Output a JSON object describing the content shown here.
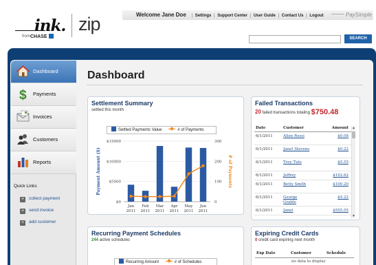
{
  "header": {
    "logo_ink": "ink.",
    "logo_from": "from",
    "logo_chase": "CHASE",
    "logo_zip": "zip",
    "welcome": "Welcome Jane Doe",
    "nav_links": [
      "Settings",
      "Support Center",
      "User Guide",
      "Contact Us",
      "Logout"
    ],
    "paysimple": "PaySimple",
    "search_button": "SEARCH",
    "search_value": ""
  },
  "sidebar": {
    "items": [
      {
        "label": "Dashboard",
        "icon": "house-icon",
        "active": true
      },
      {
        "label": "Payments",
        "icon": "dollar-icon"
      },
      {
        "label": "Invoices",
        "icon": "envelope-icon"
      },
      {
        "label": "Customers",
        "icon": "people-icon"
      },
      {
        "label": "Reports",
        "icon": "bar-chart-icon"
      }
    ],
    "quick_links_title": "Quick Links",
    "quick_links": [
      "collect payment",
      "send invoice",
      "add customer"
    ]
  },
  "page": {
    "title": "Dashboard"
  },
  "settlement": {
    "title": "Settlement Summary",
    "subtitle": "settled this month",
    "legend_value": "Settled Payments Value",
    "legend_count": "# of Payments"
  },
  "chart_data": {
    "type": "bar",
    "categories": [
      "Jan 2011",
      "Feb 2011",
      "Mar 2011",
      "Apr 2011",
      "May 2011",
      "Jun 2011"
    ],
    "category_lines": [
      [
        "Jan",
        "2011"
      ],
      [
        "Feb",
        "2011"
      ],
      [
        "Mar",
        "2011"
      ],
      [
        "Apr",
        "2011"
      ],
      [
        "May",
        "2011"
      ],
      [
        "Jun",
        "2011"
      ]
    ],
    "series": [
      {
        "name": "Settled Payments Value",
        "type": "bar",
        "axis": "left",
        "values": [
          4200,
          2700,
          13800,
          3700,
          13400,
          13300
        ]
      },
      {
        "name": "# of Payments",
        "type": "line",
        "axis": "right",
        "values": [
          27,
          25,
          25,
          27,
          138,
          178
        ]
      }
    ],
    "ylabel": "Payment Amount ($)",
    "ylabel2": "# of Payments",
    "ylim": [
      0,
      15000
    ],
    "ylim2": [
      0,
      300
    ],
    "yticks": [
      "$0",
      "$5000",
      "$10000",
      "$15000"
    ],
    "yticks2": [
      "0",
      "100",
      "200",
      "300"
    ],
    "colors": {
      "bar": "#2b5aa3",
      "line": "#f28a1c"
    }
  },
  "failed": {
    "title": "Failed Transactions",
    "count": "20",
    "text": "failed transactions totaling",
    "total": "$750.48",
    "columns": [
      "Date",
      "Customer",
      "Amount"
    ],
    "rows": [
      {
        "date": "6/1/2011",
        "customer": "Allen Rossi",
        "amount": "$0.08"
      },
      {
        "date": "6/1/2011",
        "customer": "Janet Stevens",
        "amount": "$0.22"
      },
      {
        "date": "6/1/2011",
        "customer": "Troy Tulo",
        "amount": "$5.55"
      },
      {
        "date": "6/1/2011",
        "customer": "Jeffrey",
        "amount": "$102.62"
      },
      {
        "date": "6/1/2011",
        "customer": "Betty Smith",
        "amount": "$100.20"
      },
      {
        "date": "6/1/2011",
        "customer": "George Grable",
        "amount": "$5.22"
      },
      {
        "date": "6/1/2011",
        "customer": "Janet",
        "amount": "$555.55"
      }
    ]
  },
  "recurring": {
    "title": "Recurring Payment Schedules",
    "count": "244",
    "subtitle": "active schedules",
    "legend_amount": "Recurring Amount",
    "legend_count": "# of Schedules"
  },
  "expiring": {
    "title": "Expiring Credit Cards",
    "count": "0",
    "subtitle": "credit card expiring next month",
    "columns": [
      "Exp Date",
      "Customer",
      "Schedule"
    ],
    "empty": "no data to display"
  }
}
